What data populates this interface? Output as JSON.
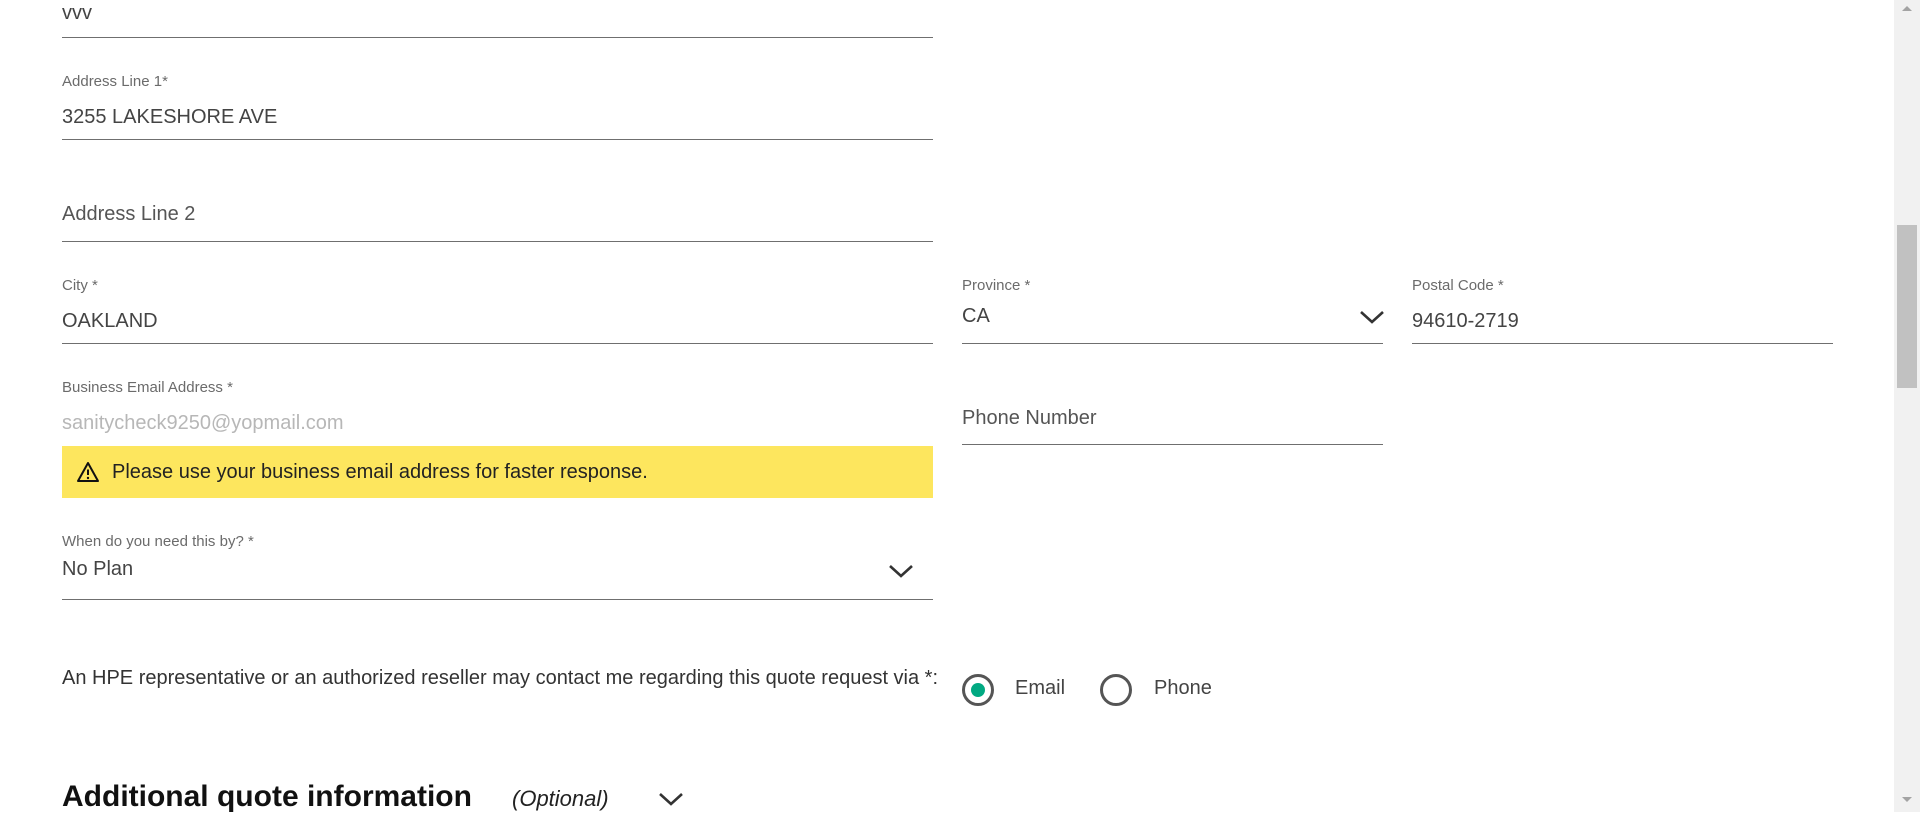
{
  "form": {
    "top_field_value": "vvv",
    "address1": {
      "label": "Address Line 1*",
      "value": "3255 LAKESHORE AVE"
    },
    "address2": {
      "placeholder": "Address Line 2"
    },
    "city": {
      "label": "City *",
      "value": "OAKLAND"
    },
    "province": {
      "label": "Province *",
      "value": "CA"
    },
    "postal": {
      "label": "Postal Code *",
      "value": "94610-2719"
    },
    "email": {
      "label": "Business Email Address *",
      "value": "sanitycheck9250@yopmail.com"
    },
    "phone": {
      "placeholder": "Phone Number"
    },
    "warning": {
      "text": "Please use your business email address for faster response.",
      "icon": "warning-triangle-icon"
    },
    "need_by": {
      "label": "When do you need this by? *",
      "value": "No Plan"
    },
    "contact": {
      "text": "An HPE representative or an authorized reseller may contact me regarding this quote request via *:",
      "options": [
        {
          "label": "Email",
          "selected": true
        },
        {
          "label": "Phone",
          "selected": false
        }
      ]
    },
    "additional": {
      "title": "Additional quote information",
      "optional": "(Optional)"
    }
  },
  "colors": {
    "accent": "#01a982",
    "warning_bg": "#fde65e"
  }
}
